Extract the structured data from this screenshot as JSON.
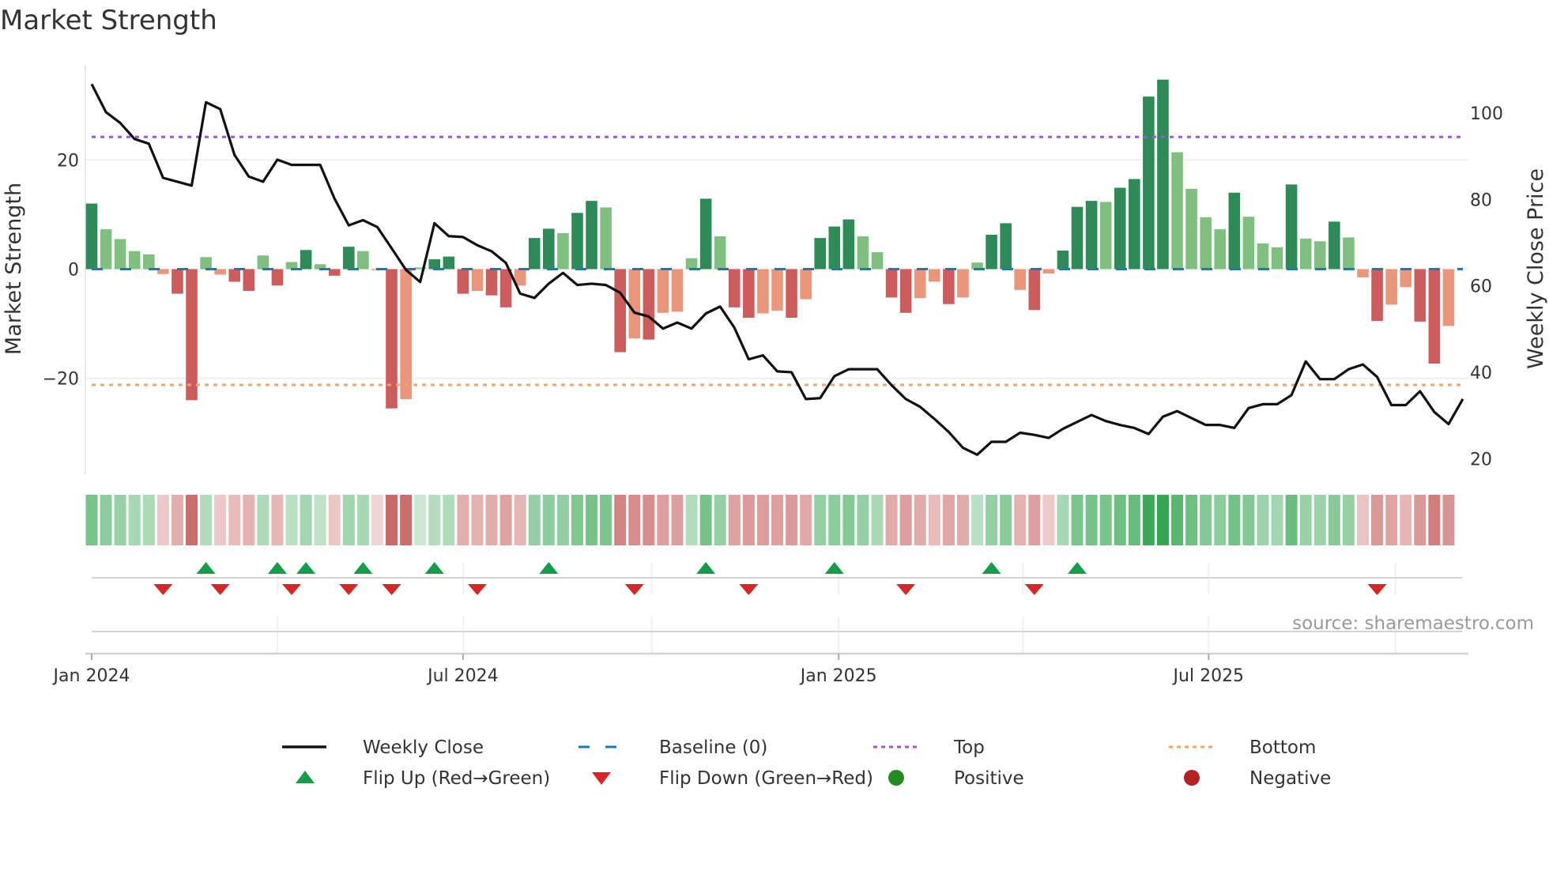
{
  "title": "Market Strength",
  "source": "source: sharemaestro.com",
  "colors": {
    "pos_rising": "#2e8b57",
    "pos_falling": "#7fbf7f",
    "neg_rising": "#cd5c5c",
    "neg_falling": "#e9967a",
    "baseline": "#1f77b4",
    "top": "#9b59d6",
    "bottom": "#f4a460",
    "close": "#111111",
    "flip_up": "#1a9a4a",
    "flip_down": "#d62728",
    "positive": "#228b22",
    "negative": "#b22222",
    "heat_pos": "#2ca24a",
    "heat_neg": "#c0504d"
  },
  "chart_data": {
    "type": "bar+line",
    "title": "Market Strength",
    "ylabel": "Market Strength",
    "y2label": "Weekly Close Price",
    "ylim": [
      -38,
      37
    ],
    "y2lim": [
      17,
      113
    ],
    "yticks": [
      {
        "v": 20,
        "label": "20"
      },
      {
        "v": 0,
        "label": "0"
      },
      {
        "v": -20,
        "label": "−20"
      }
    ],
    "y2ticks": [
      {
        "v": 100,
        "label": "100"
      },
      {
        "v": 80,
        "label": "80"
      },
      {
        "v": 60,
        "label": "60"
      },
      {
        "v": 40,
        "label": "40"
      },
      {
        "v": 20,
        "label": "20"
      }
    ],
    "xticks": [
      {
        "week": 0,
        "label": "Jan 2024"
      },
      {
        "week": 26,
        "label": "Jul 2024"
      },
      {
        "week": 52.3,
        "label": "Jan 2025"
      },
      {
        "week": 78.2,
        "label": "Jul 2025"
      }
    ],
    "quarter_grid_weeks": [
      13,
      26,
      39.2,
      52.3,
      65.2,
      78.2,
      91.3
    ],
    "top_level": 24.2,
    "bottom_level": -21.2,
    "baseline": 0,
    "strength": [
      12.0,
      7.3,
      5.5,
      3.3,
      2.7,
      -0.9,
      -4.5,
      -24.0,
      2.2,
      -1.0,
      -2.3,
      -4.0,
      2.5,
      -3.0,
      1.3,
      3.5,
      0.9,
      -1.2,
      4.1,
      3.3,
      -0.2,
      -25.5,
      -23.8,
      0.3,
      1.8,
      2.3,
      -4.5,
      -4.0,
      -4.8,
      -7.0,
      -3.0,
      5.7,
      7.4,
      6.6,
      10.3,
      12.5,
      11.3,
      -15.2,
      -12.7,
      -12.9,
      -8.0,
      -7.8,
      2.0,
      12.9,
      6.0,
      -7.0,
      -8.9,
      -8.1,
      -7.6,
      -8.9,
      -5.5,
      5.7,
      7.8,
      9.1,
      6.0,
      3.1,
      -5.2,
      -8.0,
      -5.3,
      -2.3,
      -6.4,
      -5.2,
      1.2,
      6.3,
      8.4,
      -3.8,
      -7.5,
      -0.8,
      3.4,
      11.4,
      12.5,
      12.3,
      14.9,
      16.5,
      31.6,
      34.7,
      21.4,
      14.7,
      9.5,
      7.3,
      14.0,
      9.6,
      4.7,
      4.0,
      15.5,
      5.6,
      5.1,
      8.7,
      5.8,
      -1.5,
      -9.5,
      -6.5,
      -3.3,
      -9.6,
      -17.3,
      -10.4
    ],
    "weekly_close": [
      106.7,
      100.2,
      97.7,
      94.0,
      92.9,
      85.0,
      84.1,
      83.2,
      102.5,
      100.9,
      90.3,
      85.3,
      84.1,
      89.2,
      88.0,
      88.0,
      88.0,
      80.2,
      74.0,
      75.2,
      73.6,
      68.7,
      63.7,
      60.9,
      74.5,
      71.5,
      71.3,
      69.4,
      68.0,
      65.3,
      58.2,
      57.2,
      60.5,
      63.0,
      60.2,
      60.5,
      60.2,
      58.4,
      53.8,
      52.9,
      50.1,
      51.5,
      50.1,
      53.6,
      55.2,
      50.3,
      43.0,
      43.9,
      40.2,
      40.0,
      33.8,
      34.0,
      39.1,
      40.7,
      40.7,
      40.7,
      37.0,
      33.8,
      32.0,
      29.2,
      26.2,
      22.5,
      20.9,
      23.9,
      23.9,
      26.0,
      25.5,
      24.8,
      26.9,
      28.5,
      30.1,
      28.7,
      27.8,
      27.1,
      25.7,
      29.7,
      31.0,
      29.4,
      27.8,
      27.8,
      27.1,
      31.7,
      32.6,
      32.6,
      34.7,
      42.5,
      38.4,
      38.4,
      40.7,
      41.8,
      38.9,
      32.4,
      32.4,
      35.6,
      30.8,
      28.0,
      33.8
    ],
    "flip_up_weeks": [
      8,
      13,
      15,
      19,
      24,
      32,
      43,
      52,
      63,
      69
    ],
    "flip_down_weeks": [
      5,
      9,
      14,
      18,
      21,
      27,
      38,
      46,
      57,
      66,
      90
    ]
  },
  "legend": [
    {
      "label": "Weekly Close",
      "kind": "line"
    },
    {
      "label": "Baseline (0)",
      "kind": "dash"
    },
    {
      "label": "Top",
      "kind": "dot-top"
    },
    {
      "label": "Bottom",
      "kind": "dot-bottom"
    },
    {
      "label": "Flip Up (Red→Green)",
      "kind": "tri-up"
    },
    {
      "label": "Flip Down (Green→Red)",
      "kind": "tri-down"
    },
    {
      "label": "Positive",
      "kind": "circle-pos"
    },
    {
      "label": "Negative",
      "kind": "circle-neg"
    }
  ]
}
